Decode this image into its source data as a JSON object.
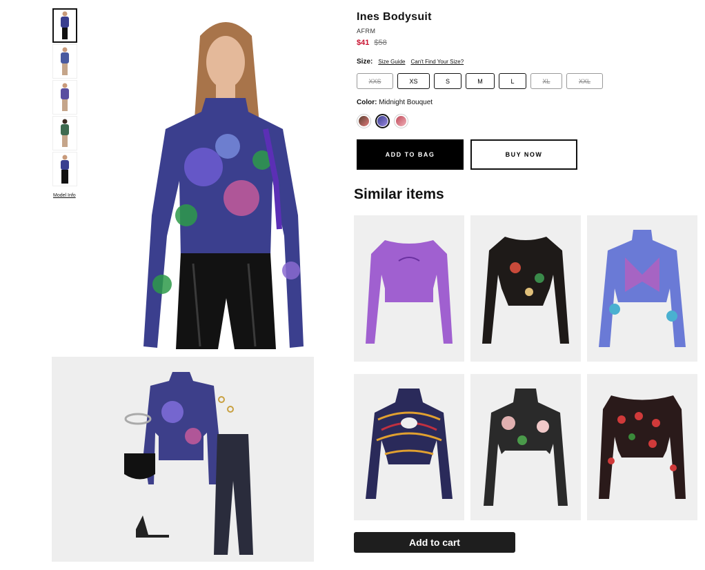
{
  "product": {
    "title": "Ines Bodysuit",
    "brand": "AFRM",
    "sale_price": "$41",
    "original_price": "$58",
    "size_label": "Size:",
    "size_guide": "Size Guide",
    "cant_find_size": "Can't Find Your Size?",
    "sizes": [
      {
        "label": "XXS",
        "available": false
      },
      {
        "label": "XS",
        "available": true
      },
      {
        "label": "S",
        "available": true
      },
      {
        "label": "M",
        "available": true
      },
      {
        "label": "L",
        "available": true
      },
      {
        "label": "XL",
        "available": false
      },
      {
        "label": "XXL",
        "available": false
      }
    ],
    "color_label": "Color:",
    "color_value": "Midnight Bouquet",
    "swatches": [
      {
        "name": "swatch-1",
        "color": "#b45a5a",
        "selected": false
      },
      {
        "name": "swatch-2",
        "color": "#5a5fa8",
        "selected": true
      },
      {
        "name": "swatch-3",
        "color": "#e38a95",
        "selected": false
      }
    ],
    "add_to_bag": "ADD TO BAG",
    "buy_now": "BUY NOW"
  },
  "gallery": {
    "model_info": "Model Info",
    "thumbnail_count": 5
  },
  "similar": {
    "title": "Similar items",
    "items": [
      {
        "name": "purple-corset-top",
        "color": "#9b59c9"
      },
      {
        "name": "black-floral-top",
        "color": "#2a2522"
      },
      {
        "name": "butterfly-print-top",
        "color": "#7a6fcf"
      },
      {
        "name": "psychedelic-cutout-top",
        "color": "#8a2a3a"
      },
      {
        "name": "floral-cutout-top",
        "color": "#b7a99e"
      },
      {
        "name": "red-floral-top",
        "color": "#a63a3a"
      }
    ],
    "add_to_cart": "Add to cart"
  },
  "colors": {
    "sale": "#c8102e",
    "button_dark": "#000000",
    "tile_bg": "#efefef"
  }
}
